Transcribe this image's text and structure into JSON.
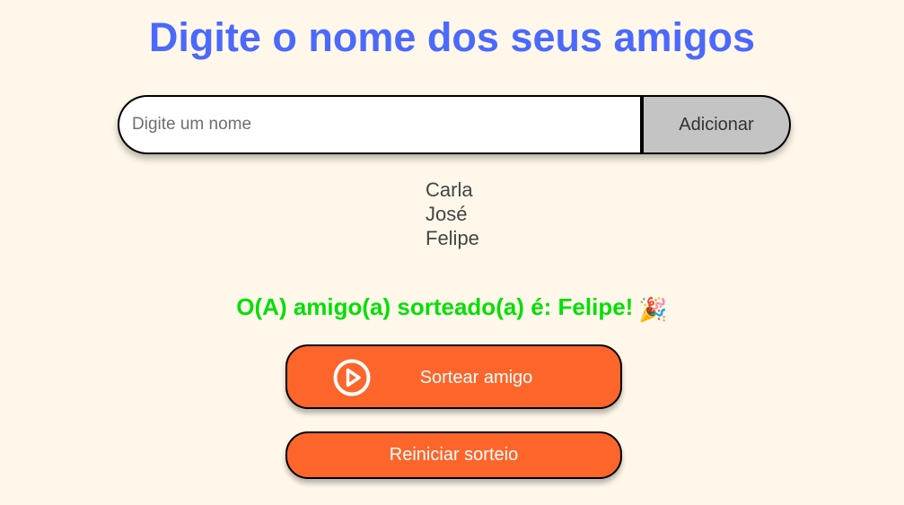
{
  "header": {
    "title": "Digite o nome dos seus amigos"
  },
  "input": {
    "placeholder": "Digite um nome",
    "value": "",
    "add_button_label": "Adicionar"
  },
  "friends": [
    "Carla",
    "José",
    "Felipe"
  ],
  "result": {
    "text": "O(A) amigo(a) sorteado(a) é: Felipe!",
    "emoji": "🎉"
  },
  "actions": {
    "draw_label": "Sortear amigo",
    "draw_icon": "play-circle-icon",
    "reset_label": "Reiniciar sorteio"
  },
  "colors": {
    "background": "#FFF8EA",
    "title": "#4B69FD",
    "result": "#05DF05",
    "primary_button": "#FE652B",
    "add_button": "#C4C4C4"
  }
}
